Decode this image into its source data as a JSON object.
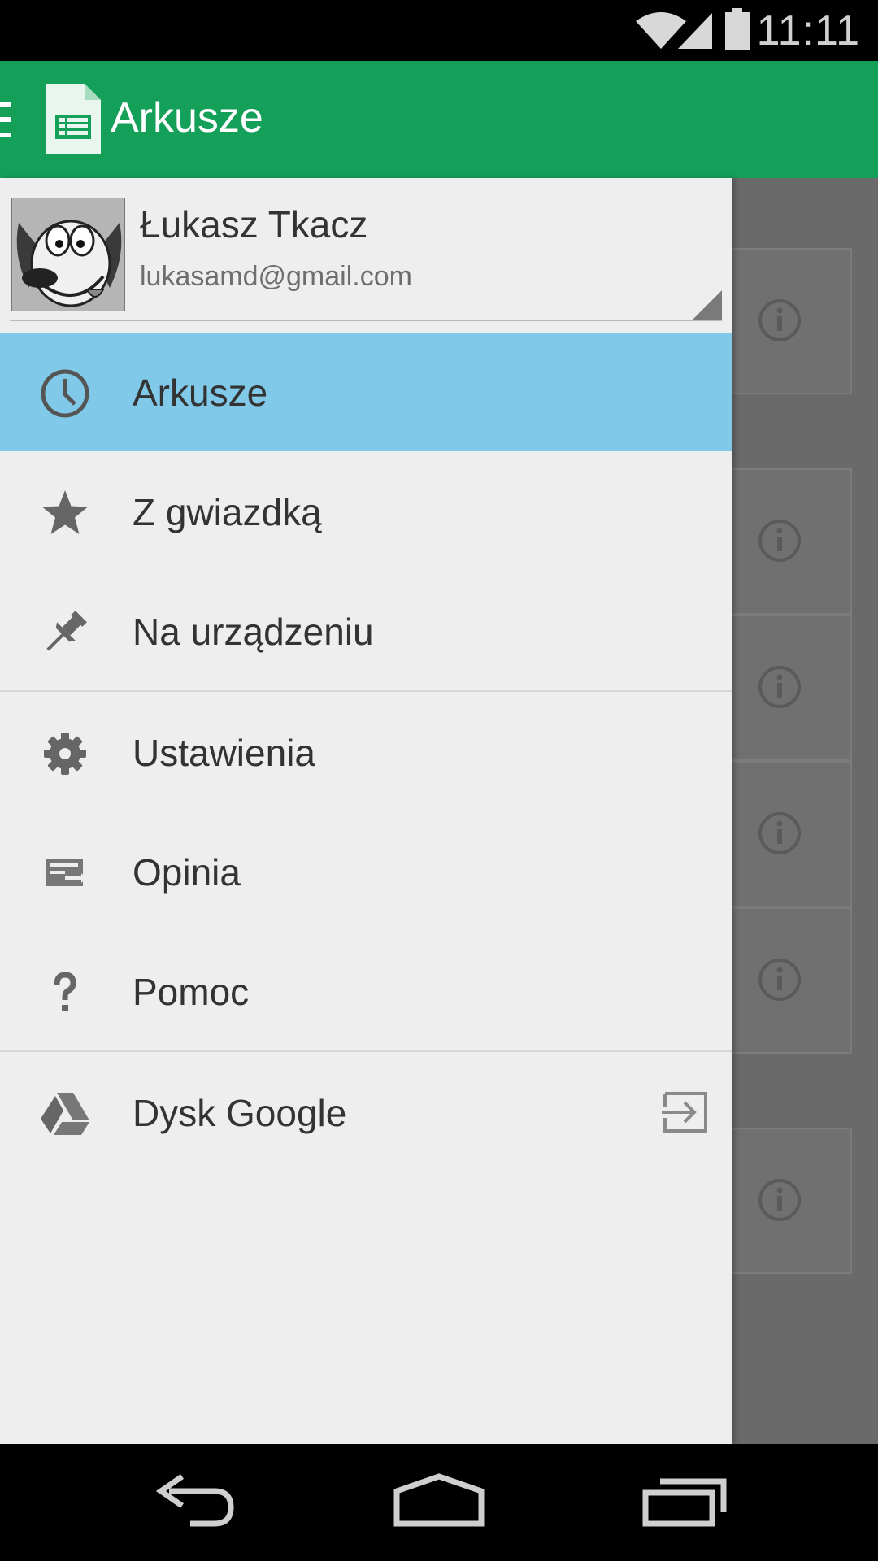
{
  "status_bar": {
    "time": "11:11"
  },
  "app_bar": {
    "title": "Arkusze"
  },
  "account": {
    "name": "Łukasz Tkacz",
    "email": "lukasamd@gmail.com"
  },
  "nav_items": [
    {
      "label": "Arkusze",
      "icon": "clock-icon",
      "active": true
    },
    {
      "label": "Z gwiazdką",
      "icon": "star-icon"
    },
    {
      "label": "Na urządzeniu",
      "icon": "pin-icon"
    },
    {
      "label": "Ustawienia",
      "icon": "gear-icon"
    },
    {
      "label": "Opinia",
      "icon": "feedback-icon"
    },
    {
      "label": "Pomoc",
      "icon": "help-icon"
    },
    {
      "label": "Dysk Google",
      "icon": "drive-icon",
      "trailing_icon": "open-in-app-icon"
    }
  ],
  "colors": {
    "app_bar": "#15a05a",
    "active_item": "#80c9e8",
    "drawer": "#eeeeee"
  }
}
